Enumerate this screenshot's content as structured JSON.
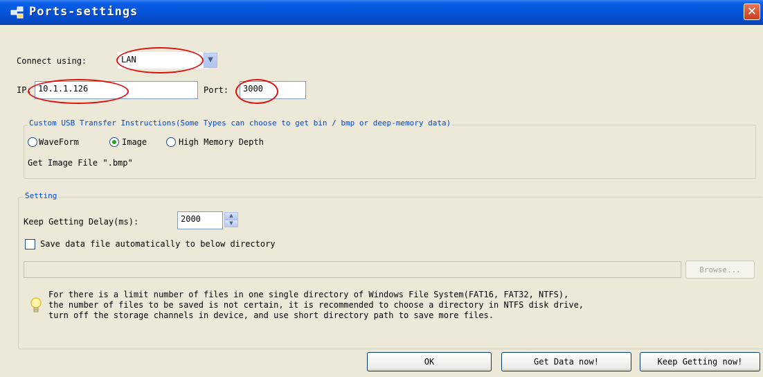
{
  "window": {
    "title": "Ports-settings",
    "close_glyph": "✕"
  },
  "connect": {
    "label": "Connect using:",
    "value": "LAN"
  },
  "ip": {
    "label": "IP:",
    "value": "10.1.1.126"
  },
  "port": {
    "label": "Port:",
    "value": "3000"
  },
  "usb_group": {
    "legend": "Custom USB Transfer Instructions(Some Types can choose to get bin / bmp or deep-memory data)",
    "radios": [
      {
        "label": "WaveForm",
        "selected": false
      },
      {
        "label": "Image",
        "selected": true
      },
      {
        "label": "High Memory Depth",
        "selected": false
      }
    ],
    "file_label": "Get Image File \".bmp\""
  },
  "setting": {
    "legend": "Setting",
    "delay_label": "Keep Getting Delay(ms):",
    "delay_value": "2000",
    "checkbox_label": "Save data file automatically to below directory",
    "checkbox_checked": false,
    "directory_value": "",
    "browse_label": "Browse..."
  },
  "info": {
    "icon": "lightbulb-icon",
    "lines": [
      "For there is a limit number of files in one single directory of Windows File System(FAT16, FAT32, NTFS),",
      "the number of  files to be saved is not certain,  it is recommended to choose a directory in NTFS disk drive,",
      "turn off the storage channels in device, and use short directory path to save more files."
    ]
  },
  "buttons": {
    "ok": "OK",
    "get_data": "Get Data now!",
    "keep_getting": "Keep Getting now!"
  },
  "colors": {
    "title_bar": "#0553d8",
    "annotation_red": "#e01010",
    "window_bg": "#ece9d8",
    "legend_blue": "#0046d5"
  }
}
